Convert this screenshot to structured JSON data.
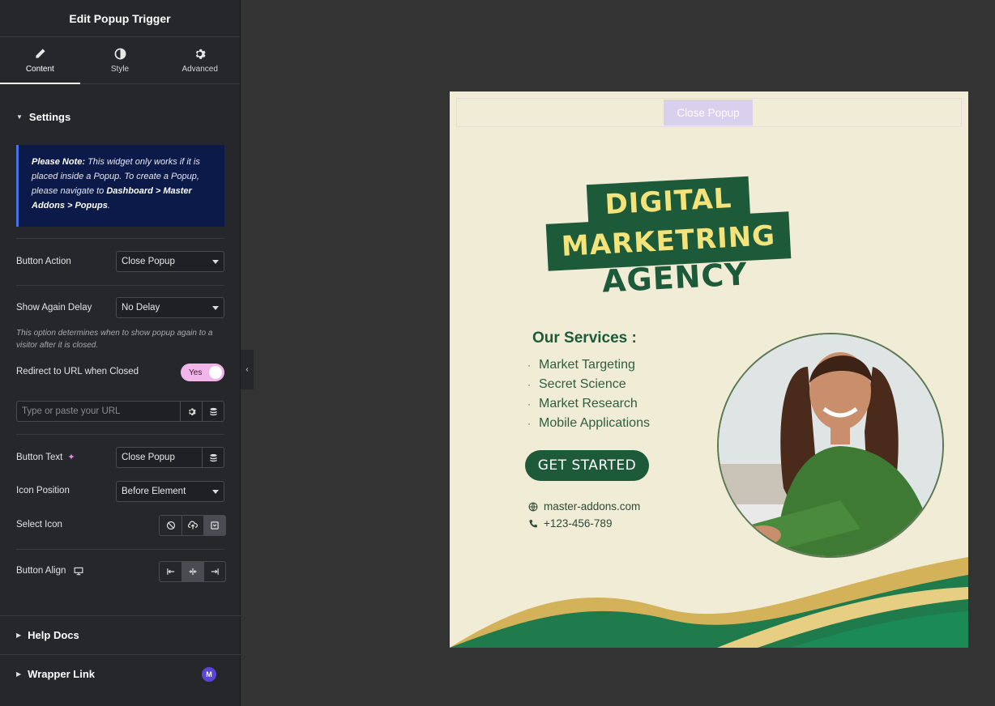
{
  "panel": {
    "title": "Edit Popup Trigger",
    "tabs": [
      {
        "label": "Content",
        "icon": "pencil-icon"
      },
      {
        "label": "Style",
        "icon": "contrast-icon"
      },
      {
        "label": "Advanced",
        "icon": "gear-icon"
      }
    ],
    "settings_title": "Settings",
    "note": {
      "lead": "Please Note:",
      "text1": " This widget only works if it is placed inside a Popup. To create a Popup, please navigate to ",
      "path": "Dashboard > Master Addons > Popups",
      "text2": "."
    },
    "button_action": {
      "label": "Button Action",
      "value": "Close Popup"
    },
    "show_again_delay": {
      "label": "Show Again Delay",
      "value": "No Delay",
      "help": "This option determines when to show popup again to a visitor after it is closed."
    },
    "redirect": {
      "label": "Redirect to URL when Closed",
      "toggle": "Yes"
    },
    "url": {
      "placeholder": "Type or paste your URL"
    },
    "button_text": {
      "label": "Button Text",
      "value": "Close Popup"
    },
    "icon_position": {
      "label": "Icon Position",
      "value": "Before Element"
    },
    "select_icon": {
      "label": "Select Icon"
    },
    "button_align": {
      "label": "Button Align"
    },
    "help_docs": "Help Docs",
    "wrapper_link": "Wrapper Link",
    "logo_letter": "M"
  },
  "popup": {
    "close_button": "Close Popup",
    "title_line1": "DIGITAL",
    "title_line2": "MARKETRING",
    "title_line3": "AGENCY",
    "services_title": "Our Services :",
    "services": [
      "Market Targeting",
      "Secret Science",
      "Market Research",
      "Mobile Applications"
    ],
    "cta": "GET STARTED",
    "website": "master-addons.com",
    "phone": "+123-456-789"
  },
  "colors": {
    "panel_bg": "#26272b",
    "canvas_bg": "#333333",
    "popup_bg": "#f0ecd6",
    "brand_green": "#1d5a3a",
    "title_yellow": "#f4e27a",
    "toggle_pink": "#f1b5ea",
    "note_bg": "#0c1a4a"
  }
}
